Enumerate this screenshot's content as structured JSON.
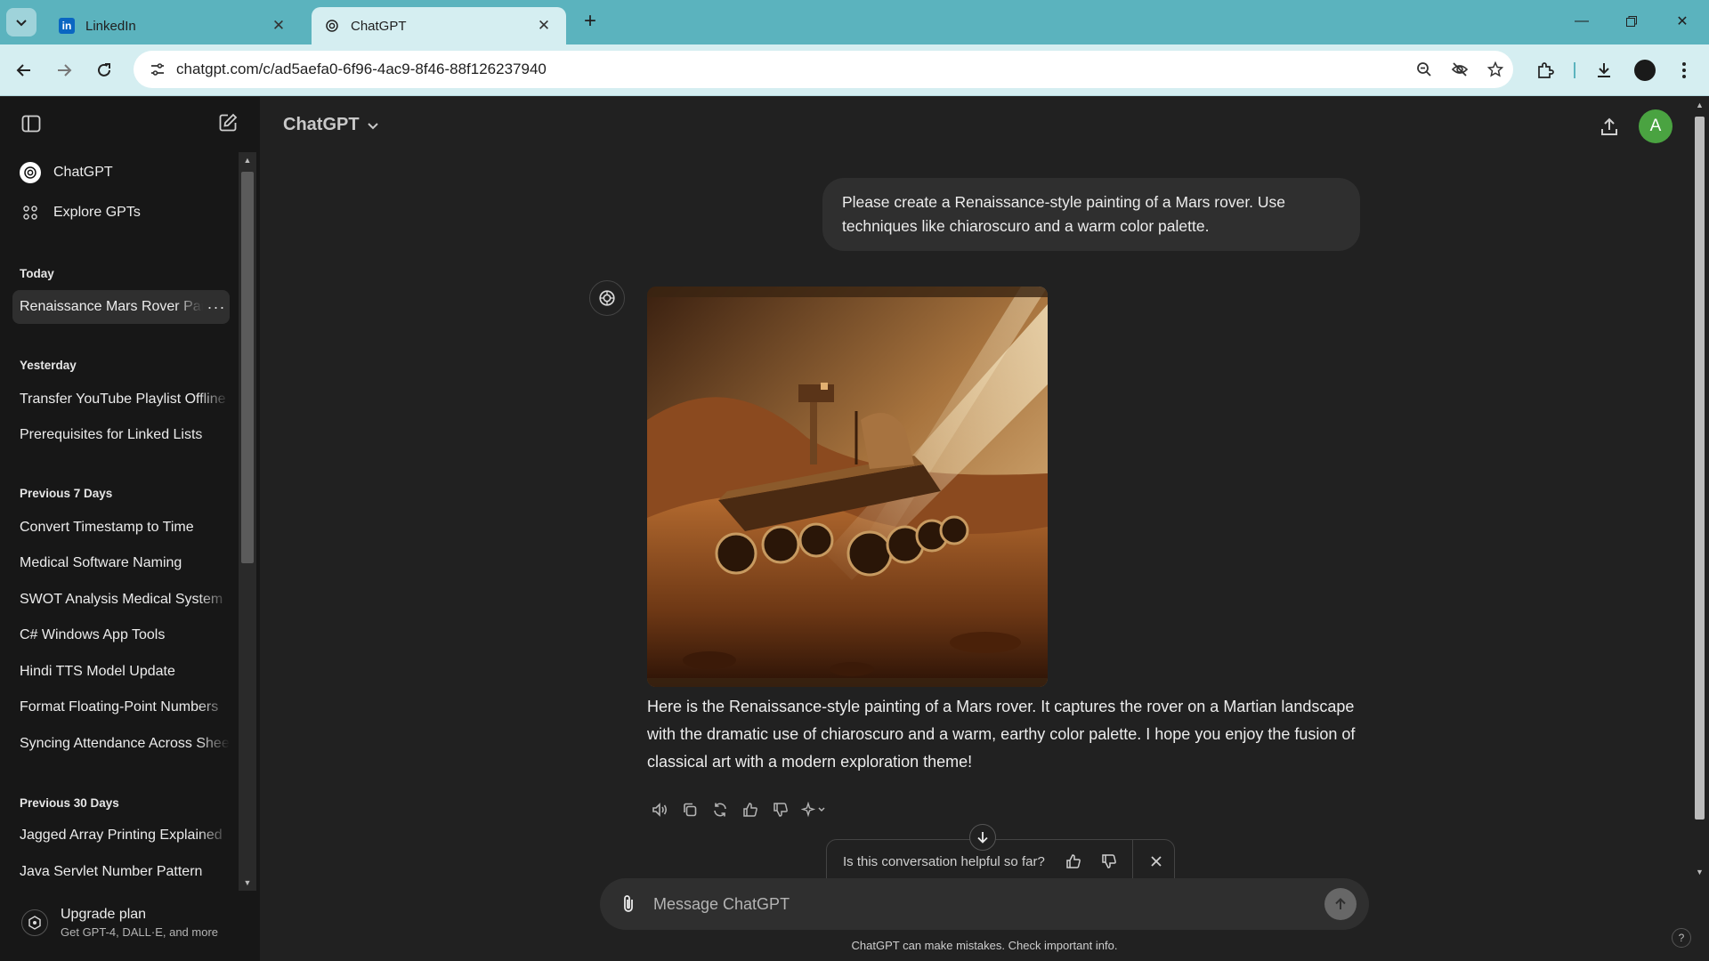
{
  "browser": {
    "tabs": [
      {
        "title": "LinkedIn",
        "icon": "linkedin-icon"
      },
      {
        "title": "ChatGPT",
        "icon": "openai-icon"
      }
    ],
    "url": "chatgpt.com/c/ad5aefa0-6f96-4ac9-8f46-88f126237940",
    "profile_color": "#1a1a1a"
  },
  "sidebar": {
    "nav": [
      {
        "label": "ChatGPT",
        "icon": "openai-icon"
      },
      {
        "label": "Explore GPTs",
        "icon": "grid-icon"
      }
    ],
    "sections": {
      "today": "Today",
      "yesterday": "Yesterday",
      "prev7": "Previous 7 Days",
      "prev30": "Previous 30 Days"
    },
    "today_items": [
      "Renaissance Mars Rover Painting"
    ],
    "yesterday_items": [
      "Transfer YouTube Playlist Offline",
      "Prerequisites for Linked Lists"
    ],
    "prev7_items": [
      "Convert Timestamp to Time",
      "Medical Software Naming",
      "SWOT Analysis Medical System",
      "C# Windows App Tools",
      "Hindi TTS Model Update",
      "Format Floating-Point Numbers",
      "Syncing Attendance Across Sheets"
    ],
    "prev30_items": [
      "Jagged Array Printing Explained",
      "Java Servlet Number Pattern"
    ],
    "upgrade": {
      "title": "Upgrade plan",
      "subtitle": "Get GPT-4, DALL·E, and more"
    }
  },
  "main": {
    "model": "ChatGPT",
    "avatar_letter": "A",
    "user_message": "Please create a Renaissance-style painting of a Mars rover. Use techniques like chiaroscuro and a warm color palette.",
    "assistant_message": "Here is the Renaissance-style painting of a Mars rover. It captures the rover on a Martian landscape with the dramatic use of chiaroscuro and a warm, earthy color palette. I hope you enjoy the fusion of classical art with a modern exploration theme!",
    "feedback_question": "Is this conversation helpful so far?",
    "composer_placeholder": "Message ChatGPT",
    "disclaimer": "ChatGPT can make mistakes. Check important info.",
    "help": "?"
  },
  "colors": {
    "tab_strip": "#5bb3be",
    "toolbar": "#d5eef1",
    "sidebar_bg": "#171717",
    "main_bg": "#212121",
    "bubble_bg": "#2f2f2f",
    "avatar_bg": "#4aa341"
  }
}
